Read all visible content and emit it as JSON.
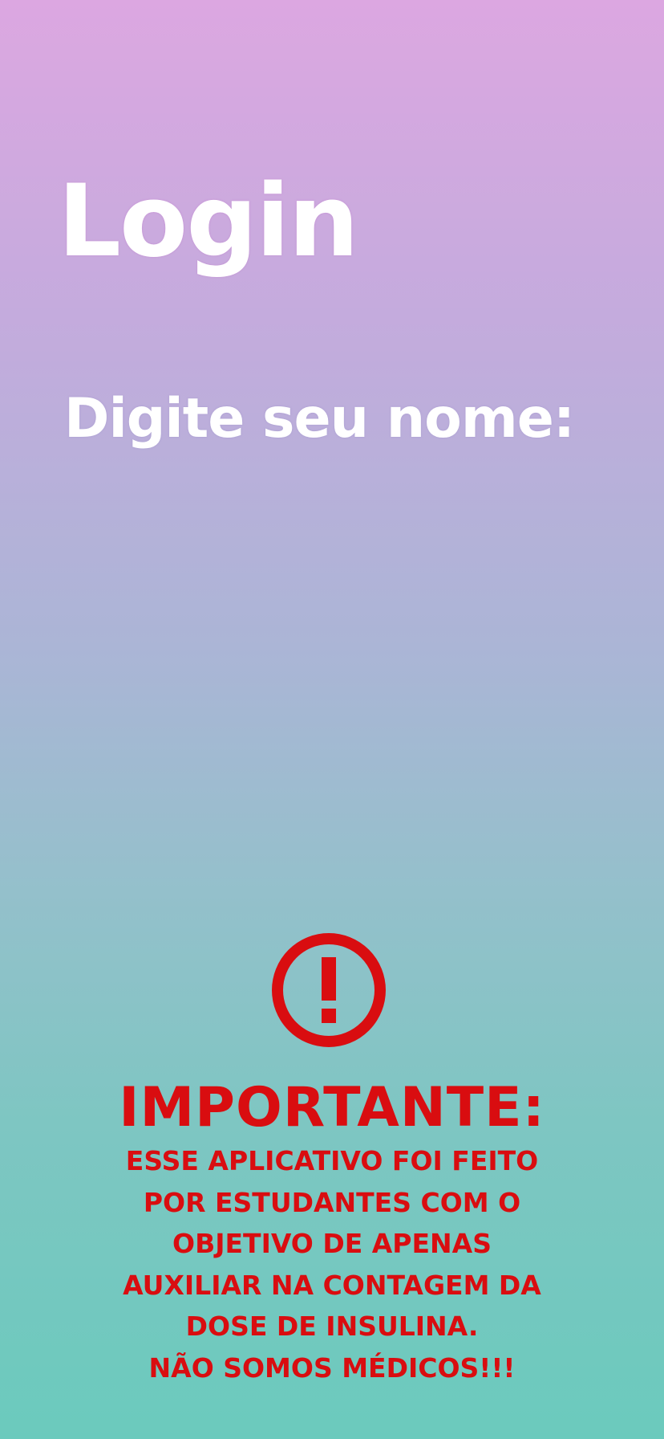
{
  "screen": {
    "title": "Login",
    "name_prompt": "Digite seu nome:",
    "name_input_value": ""
  },
  "warning": {
    "icon": "exclamation-circle-icon",
    "heading": "IMPORTANTE:",
    "lines": [
      "ESSE APLICATIVO FOI FEITO",
      "POR ESTUDANTES COM O",
      "OBJETIVO DE APENAS",
      "AUXILIAR NA CONTAGEM DA",
      "DOSE DE INSULINA.",
      "NÃO SOMOS MÉDICOS!!!"
    ]
  },
  "colors": {
    "gradient_top": "#dca7e1",
    "gradient_bottom": "#6bcabd",
    "text_primary": "#ffffff",
    "warning_red": "#d90d10"
  }
}
